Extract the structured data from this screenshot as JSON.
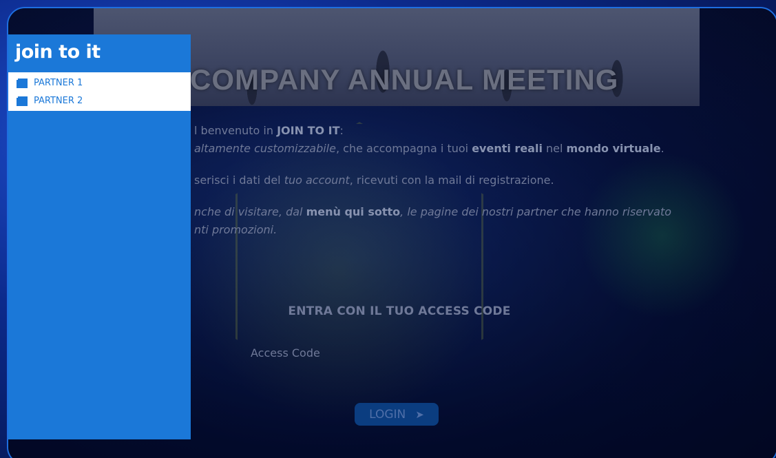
{
  "app": {
    "logo_text": "join to it"
  },
  "sidebar": {
    "items": [
      {
        "label": "PARTNER 1",
        "icon": "book-icon"
      },
      {
        "label": "PARTNER 2",
        "icon": "book-icon"
      }
    ]
  },
  "banner": {
    "title": "COMPANY ANNUAL MEETING"
  },
  "intro": {
    "line1_prefix": "l benvenuto in ",
    "line1_brand": "JOIN TO IT",
    "line1_suffix": ":",
    "line2_italic": "altamente customizzabile",
    "line2_mid": ", che accompagna i tuoi ",
    "line2_bold1": "eventi reali",
    "line2_mid2": " nel ",
    "line2_bold2": "mondo virtuale",
    "line2_end": ".",
    "para2_prefix": "serisci i dati del ",
    "para2_italic": "tuo account",
    "para2_suffix": ", ricevuti con la mail di registrazione.",
    "para3_italic1": "nche di visitare, dal ",
    "para3_bold": "menù qui sotto",
    "para3_italic2": ", le pagine dei nostri partner che hanno riservato",
    "para3_line2": "nti promozioni."
  },
  "login": {
    "heading": "ENTRA CON IL TUO ACCESS CODE",
    "input_placeholder": "Access Code",
    "input_value": "",
    "button_label": "LOGIN",
    "button_icon": "send-arrow-icon"
  },
  "colors": {
    "sidebar_bg": "#1b78d8",
    "frame_border": "#1e6ee0",
    "login_button_bg": "#0b3d80"
  }
}
